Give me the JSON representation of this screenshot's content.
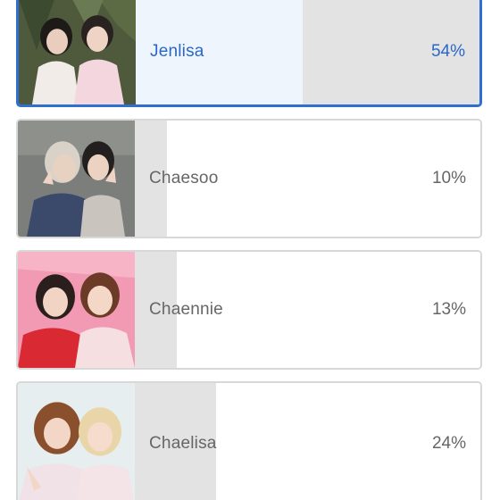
{
  "poll": {
    "options": [
      {
        "name": "Jenlisa",
        "percent_label": "54%",
        "percent": 54,
        "selected": true,
        "photo": "two-people-photo"
      },
      {
        "name": "Chaesoo",
        "percent_label": "10%",
        "percent": 10,
        "selected": false,
        "photo": "two-people-selfie-photo"
      },
      {
        "name": "Chaennie",
        "percent_label": "13%",
        "percent": 13,
        "selected": false,
        "photo": "two-people-pink-photo"
      },
      {
        "name": "Chaelisa",
        "percent_label": "24%",
        "percent": 24,
        "selected": false,
        "photo": "two-people-hug-photo"
      }
    ]
  },
  "colors": {
    "accent": "#2a67c7",
    "selected_border": "#2f6fcf",
    "bar_fill": "#e3e3e3",
    "selected_fill": "#eef5fd",
    "text": "#666666"
  }
}
